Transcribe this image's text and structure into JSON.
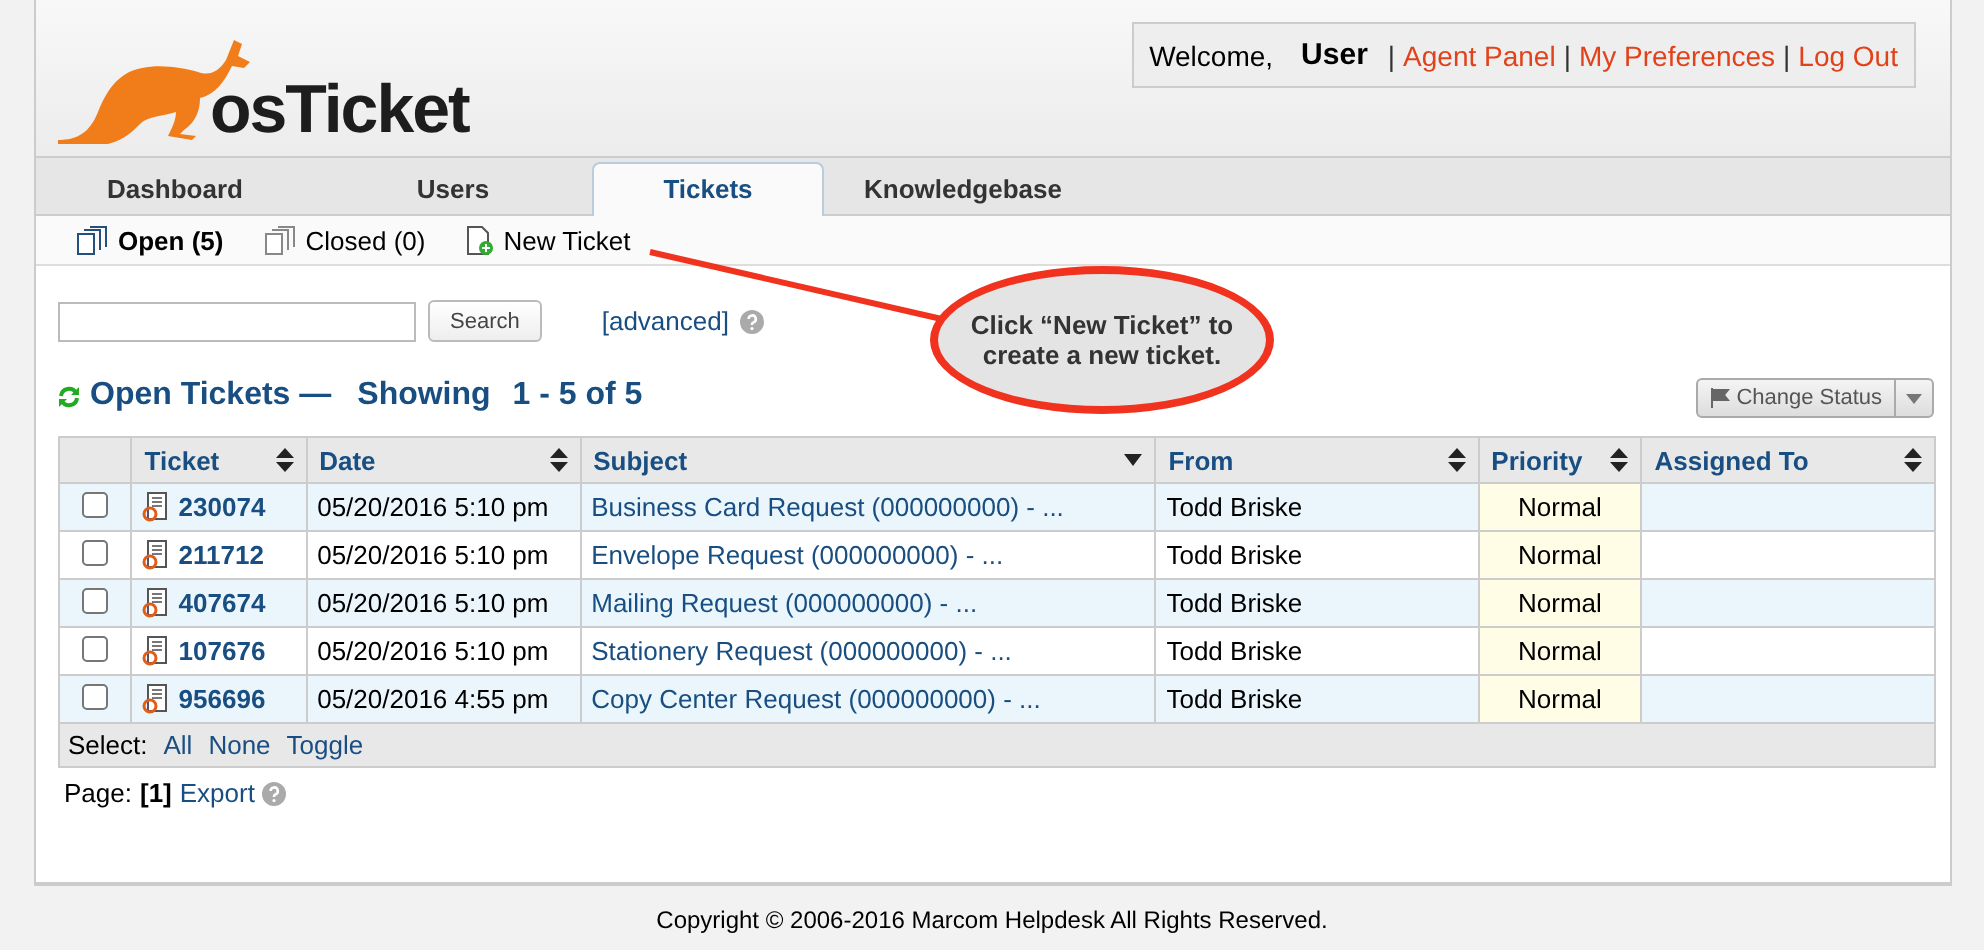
{
  "header": {
    "logo": "osTicket",
    "welcome": "Welcome,",
    "user": "User",
    "separator": "|",
    "links": [
      "Agent Panel",
      "My Preferences",
      "Log Out"
    ]
  },
  "tabs": [
    {
      "label": "Dashboard",
      "selected": false
    },
    {
      "label": "Users",
      "selected": false
    },
    {
      "label": "Tickets",
      "selected": true
    },
    {
      "label": "Knowledgebase",
      "selected": false
    }
  ],
  "subnav": [
    {
      "label": "Open (5)",
      "kind": "open",
      "selected": true
    },
    {
      "label": "Closed (0)",
      "kind": "closed",
      "selected": false
    },
    {
      "label": "New Ticket",
      "kind": "new",
      "selected": false
    }
  ],
  "search": {
    "button": "Search",
    "advanced": "[advanced]"
  },
  "heading": {
    "title": "Open Tickets —",
    "showing": "Showing",
    "range": "1 - 5 of 5"
  },
  "change_status": "Change Status",
  "table": {
    "columns": [
      {
        "label": "Ticket",
        "sorted": false
      },
      {
        "label": "Date",
        "sorted": false
      },
      {
        "label": "Subject",
        "sorted": true
      },
      {
        "label": "From",
        "sorted": false
      },
      {
        "label": "Priority",
        "sorted": false
      },
      {
        "label": "Assigned To",
        "sorted": false
      }
    ],
    "rows": [
      {
        "checked": false,
        "ticket": "230074",
        "date": "05/20/2016 5:10 pm",
        "subject": "Business Card Request (000000000) - ...",
        "from": "Todd Briske",
        "priority": "Normal"
      },
      {
        "checked": false,
        "ticket": "211712",
        "date": "05/20/2016 5:10 pm",
        "subject": "Envelope Request (000000000) - ...",
        "from": "Todd Briske",
        "priority": "Normal"
      },
      {
        "checked": false,
        "ticket": "407674",
        "date": "05/20/2016 5:10 pm",
        "subject": "Mailing Request (000000000) - ...",
        "from": "Todd Briske",
        "priority": "Normal"
      },
      {
        "checked": false,
        "ticket": "107676",
        "date": "05/20/2016 5:10 pm",
        "subject": "Stationery Request (000000000) - ...",
        "from": "Todd Briske",
        "priority": "Normal"
      },
      {
        "checked": false,
        "ticket": "956696",
        "date": "05/20/2016 4:55 pm",
        "subject": "Copy Center Request (000000000) - ...",
        "from": "Todd Briske",
        "priority": "Normal"
      }
    ]
  },
  "select": {
    "label": "Select:",
    "links": [
      "All",
      "None",
      "Toggle"
    ]
  },
  "pager": {
    "label": "Page:",
    "current": "[1]",
    "export": "Export"
  },
  "callout": "Click “New Ticket” to create a new ticket.",
  "footer": "Copyright © 2006-2016 Marcom Helpdesk All Rights Reserved."
}
